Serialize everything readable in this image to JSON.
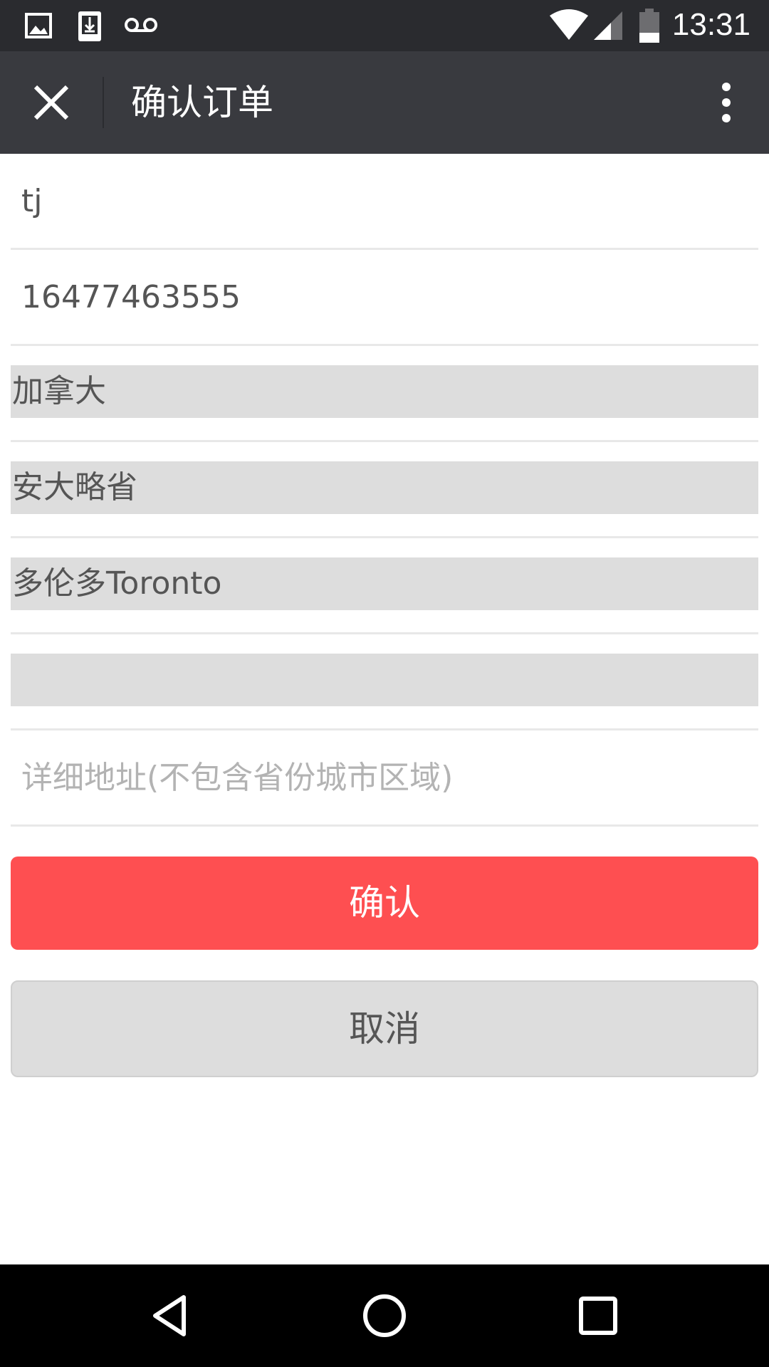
{
  "status_bar": {
    "time": "13:31",
    "left_icons": [
      "image-icon",
      "download-icon",
      "voicemail-icon"
    ],
    "right_icons": [
      "wifi-icon",
      "signal-icon",
      "battery-icon"
    ]
  },
  "app_bar": {
    "title": "确认订单"
  },
  "form": {
    "name_value": "tj",
    "phone_value": "16477463555",
    "country": "加拿大",
    "province": "安大略省",
    "city": "多伦多Toronto",
    "district": "",
    "address_placeholder": "详细地址(不包含省份城市区域)"
  },
  "buttons": {
    "confirm": "确认",
    "cancel": "取消"
  },
  "colors": {
    "status_bar": "#2a2b2f",
    "app_bar": "#393a3f",
    "confirm": "#fe4f51",
    "select_bg": "#dddddd"
  }
}
